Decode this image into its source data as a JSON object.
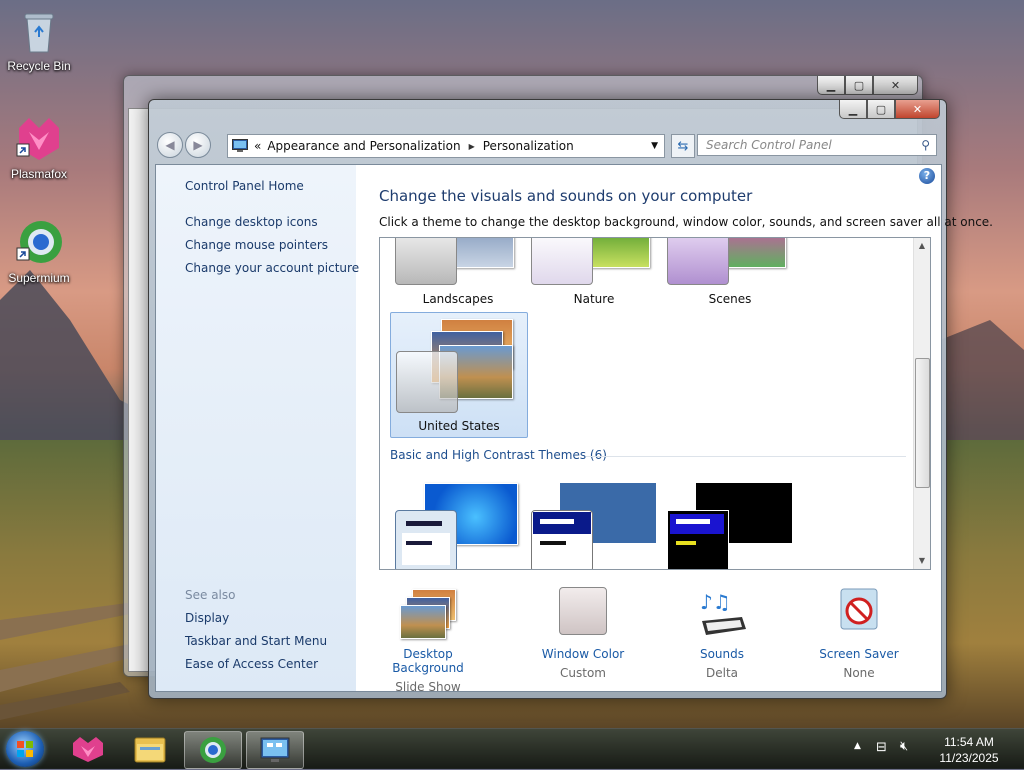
{
  "desktop": {
    "icons": [
      {
        "label": "Recycle Bin"
      },
      {
        "label": "Plasmafox"
      },
      {
        "label": "Supermium"
      }
    ]
  },
  "window": {
    "breadcrumb": [
      "Appearance and Personalization",
      "Personalization"
    ],
    "breadcrumb_prefix": "«",
    "search_placeholder": "Search Control Panel"
  },
  "sidebar": {
    "home": "Control Panel Home",
    "tasks": [
      "Change desktop icons",
      "Change mouse pointers",
      "Change your account picture"
    ],
    "see_also_label": "See also",
    "see_also": [
      "Display",
      "Taskbar and Start Menu",
      "Ease of Access Center"
    ]
  },
  "main": {
    "title": "Change the visuals and sounds on your computer",
    "subtitle": "Click a theme to change the desktop background, window color, sounds, and screen saver all at once.",
    "themes_row1": [
      "Landscapes",
      "Nature",
      "Scenes"
    ],
    "selected_theme": "United States",
    "basic_group": "Basic and High Contrast Themes (6)"
  },
  "bottom": [
    {
      "link": "Desktop Background",
      "value": "Slide Show"
    },
    {
      "link": "Window Color",
      "value": "Custom"
    },
    {
      "link": "Sounds",
      "value": "Delta"
    },
    {
      "link": "Screen Saver",
      "value": "None"
    }
  ],
  "taskbar": {
    "time": "11:54 AM",
    "date": "11/23/2025"
  },
  "colors": {
    "link": "#1a5aa6",
    "title": "#1e3c6e",
    "selection": "#cde0f5"
  }
}
